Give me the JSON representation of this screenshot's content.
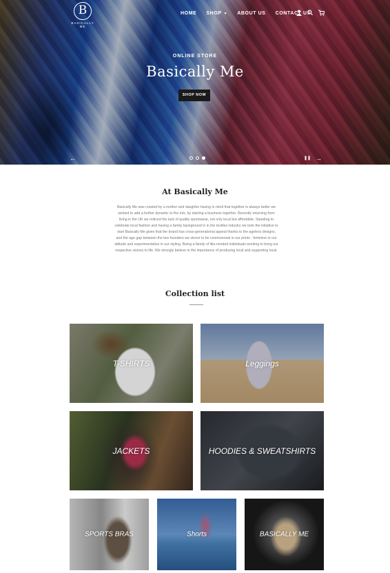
{
  "header": {
    "logo_letter": "B",
    "logo_text": "BASICALLY ME",
    "nav": [
      "HOME",
      "SHOP",
      "ABOUT US",
      "CONTACT US"
    ],
    "icons": [
      "user-icon",
      "search-icon",
      "cart-icon"
    ]
  },
  "hero": {
    "subtitle": "ONLINE STORE",
    "title": "Basically Me",
    "button": "SHOP NOW",
    "prev": "←",
    "next": "→",
    "pause": "❚❚"
  },
  "about": {
    "title": "At Basically Me",
    "text": "Basically Me was created by a mother and daughter having in mind that together is always better we wished to add a further dynamic to the mix, by starting a business together. Recently returning from living in the UK we noticed the lack of quality sportswear, not only local but affordable. Standing to celebrate local fashion and having a family background in in the textiles industry we took the initiative to start Basically Me given that the brand has cross-generational appeal thanks to the ageless designs, and the age gap between the two founders we strove to be controversial in our prints - feminine in our attitude and experimentative in our styling. Being a family of like-minded individuals working to bring our respective visions to life. We strongly believe in the importance of producing local and supporting local."
  },
  "collections": {
    "title": "Collection list",
    "items": [
      "T-SHIRTS",
      "Leggings",
      "JACKETS",
      "HOODIES & SWEATSHIRTS",
      "SPORTS BRAS",
      "Shorts",
      "BASICALLY ME"
    ]
  }
}
